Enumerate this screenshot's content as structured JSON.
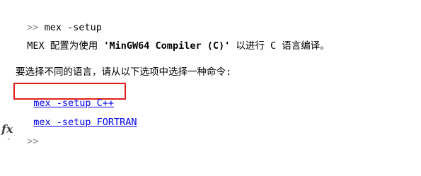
{
  "console": {
    "prompt": ">>",
    "command": " mex -setup",
    "result": {
      "prefix": "MEX 配置为使用 ",
      "compiler": "'MinGW64 Compiler (C)'",
      "suffix": " 以进行 C 语言编译。"
    },
    "choose_text": "要选择不同的语言，请从以下选项中选择一种命令:",
    "options": [
      {
        "label": "mex -setup C++"
      },
      {
        "label": "mex -setup FORTRAN"
      }
    ],
    "fx_label": "fx",
    "fx_arrow": "⌄",
    "active_prompt": ">>"
  },
  "highlight_color": "#e0201b",
  "link_color": "#0000ee"
}
